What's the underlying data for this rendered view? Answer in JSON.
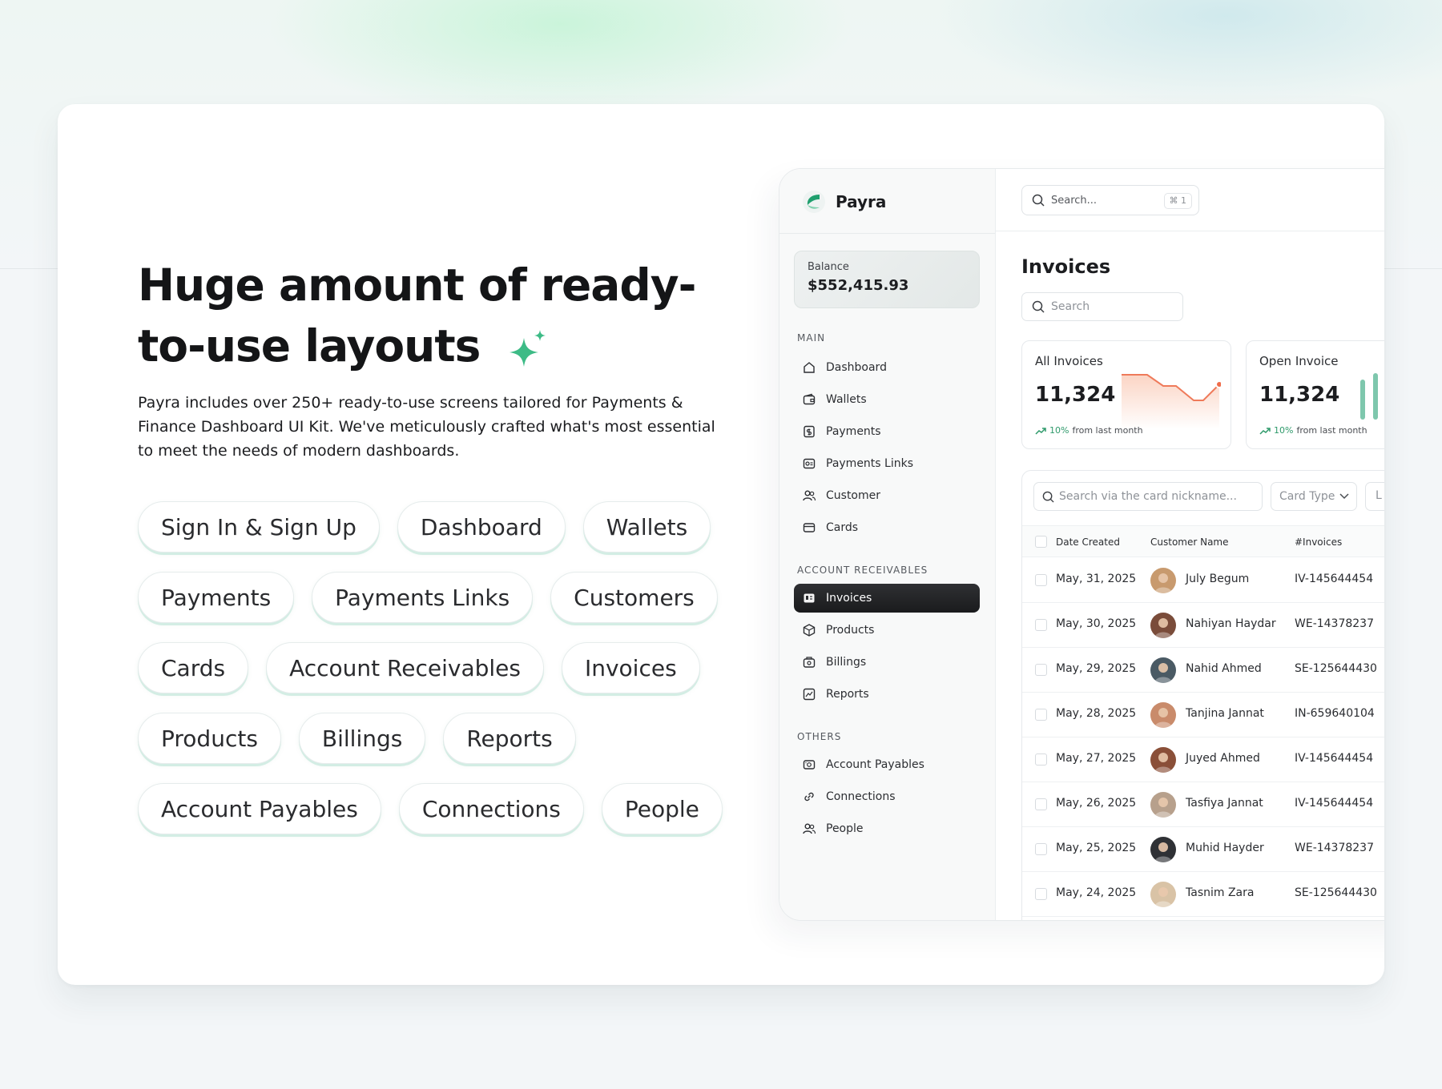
{
  "hero": {
    "headline_line1": "Huge amount of ready-",
    "headline_line2": "to-use layouts",
    "description": "Payra includes over 250+ ready-to-use screens tailored for Payments & Finance Dashboard UI Kit. We've meticulously crafted what's most essential to meet the needs of modern dashboards.",
    "chips": [
      "Sign In & Sign Up",
      "Dashboard",
      "Wallets",
      "Payments",
      "Payments Links",
      "Customers",
      "Cards",
      "Account Receivables",
      "Invoices",
      "Products",
      "Billings",
      "Reports",
      "Account Payables",
      "Connections",
      "People"
    ],
    "accent_color": "#3dbb86"
  },
  "dashboard": {
    "brand": "Payra",
    "global_search": {
      "placeholder": "Search...",
      "shortcut": "⌘ 1"
    },
    "balance": {
      "label": "Balance",
      "value": "$552,415.93"
    },
    "sections": {
      "main": "MAIN",
      "receivables": "ACCOUNT RECEIVABLES",
      "others": "OTHERS"
    },
    "nav_main": [
      {
        "label": "Dashboard",
        "icon": "home-icon"
      },
      {
        "label": "Wallets",
        "icon": "wallet-icon"
      },
      {
        "label": "Payments",
        "icon": "dollar-doc-icon"
      },
      {
        "label": "Payments Links",
        "icon": "link-card-icon"
      },
      {
        "label": "Customer",
        "icon": "users-icon"
      },
      {
        "label": "Cards",
        "icon": "card-icon"
      }
    ],
    "nav_receivables": [
      {
        "label": "Invoices",
        "icon": "invoice-icon",
        "active": true
      },
      {
        "label": "Products",
        "icon": "box-icon"
      },
      {
        "label": "Billings",
        "icon": "billing-icon"
      },
      {
        "label": "Reports",
        "icon": "report-icon"
      }
    ],
    "nav_others": [
      {
        "label": "Account Payables",
        "icon": "payables-icon"
      },
      {
        "label": "Connections",
        "icon": "link-icon"
      },
      {
        "label": "People",
        "icon": "people-icon"
      }
    ],
    "page_title": "Invoices",
    "page_search_placeholder": "Search",
    "stats": [
      {
        "label": "All Invoices",
        "value": "11,324",
        "trend_pct": "10%",
        "trend_text": "from last month"
      },
      {
        "label": "Open Invoice",
        "value": "11,324",
        "trend_pct": "10%",
        "trend_text": "from last month"
      }
    ],
    "table": {
      "search_placeholder": "Search via the card nickname...",
      "filter_label": "Card Type",
      "extra_filter": "L",
      "columns": [
        "Date Created",
        "Customer Name",
        "#Invoices"
      ],
      "rows": [
        {
          "date": "May, 31, 2025",
          "name": "July Begum",
          "invoice": "IV-145644454",
          "avatar_color": "#c89a6e"
        },
        {
          "date": "May, 30, 2025",
          "name": "Nahiyan Haydar",
          "invoice": "WE-14378237",
          "avatar_color": "#7a4c3a"
        },
        {
          "date": "May, 29, 2025",
          "name": "Nahid Ahmed",
          "invoice": "SE-125644430",
          "avatar_color": "#4a5a64"
        },
        {
          "date": "May, 28, 2025",
          "name": "Tanjina Jannat",
          "invoice": "IN-659640104",
          "avatar_color": "#c98b6b"
        },
        {
          "date": "May, 27, 2025",
          "name": "Juyed Ahmed",
          "invoice": "IV-145644454",
          "avatar_color": "#8a4f38"
        },
        {
          "date": "May, 26, 2025",
          "name": "Tasfiya Jannat",
          "invoice": "IV-145644454",
          "avatar_color": "#b7a08c"
        },
        {
          "date": "May, 25, 2025",
          "name": "Muhid Hayder",
          "invoice": "WE-14378237",
          "avatar_color": "#2f3135"
        },
        {
          "date": "May, 24, 2025",
          "name": "Tasnim Zara",
          "invoice": "SE-125644430",
          "avatar_color": "#d9c3a6"
        }
      ]
    }
  }
}
